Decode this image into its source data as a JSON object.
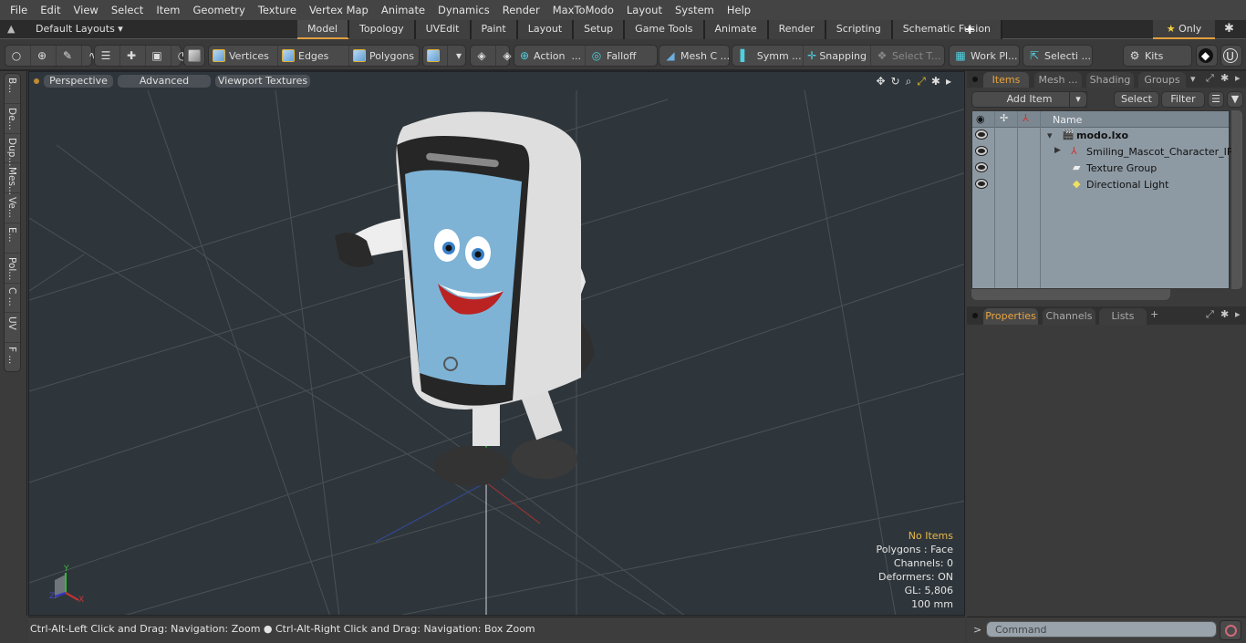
{
  "menubar": [
    "File",
    "Edit",
    "View",
    "Select",
    "Item",
    "Geometry",
    "Texture",
    "Vertex Map",
    "Animate",
    "Dynamics",
    "Render",
    "MaxToModo",
    "Layout",
    "System",
    "Help"
  ],
  "layoutbar": {
    "layouts_label": "Default Layouts ▾",
    "tabs": [
      "Model",
      "Topology",
      "UVEdit",
      "Paint",
      "Layout",
      "Setup",
      "Game Tools",
      "Animate",
      "Render",
      "Scripting",
      "Schematic Fusion"
    ],
    "active_tab": "Model",
    "add_tab": "+",
    "only_label": "Only"
  },
  "toolbar": {
    "vertices": "Vertices",
    "edges": "Edges",
    "polygons": "Polygons",
    "action": "Action",
    "falloff": "Falloff",
    "mesh_constraint": "Mesh C ...",
    "symmetry": "Symm ...",
    "snapping": "Snapping",
    "select_through": "Select T...",
    "work_plane": "Work Pl...",
    "selection": "Selecti ...",
    "kits": "Kits",
    "ellipsis": "..."
  },
  "left_tabs": [
    "B...",
    "De...",
    "Dup...",
    "Mes...",
    "Ve...",
    "E...",
    "Pol...",
    "C ...",
    "UV",
    "F ..."
  ],
  "viewport": {
    "perspective": "Perspective",
    "advanced": "Advanced",
    "textures": "Viewport Textures",
    "info": {
      "selection": "No Items",
      "polygons": "Polygons : Face",
      "channels": "Channels: 0",
      "deformers": "Deformers: ON",
      "gl": "GL: 5,806",
      "unit": "100 mm"
    },
    "axis": {
      "x": "X",
      "y": "Y",
      "z": "Z"
    }
  },
  "status": "Ctrl-Alt-Left Click and Drag: Navigation: Zoom ● Ctrl-Alt-Right Click and Drag: Navigation: Box Zoom",
  "items_panel": {
    "tabs": [
      "Items",
      "Mesh ...",
      "Shading",
      "Groups"
    ],
    "active_tab": "Items",
    "add_item": "Add Item",
    "select": "Select",
    "filter": "Filter",
    "column_name": "Name",
    "rows": [
      {
        "name": "modo.lxo",
        "bold": true
      },
      {
        "name": "Smiling_Mascot_Character_IP..."
      },
      {
        "name": "Texture Group"
      },
      {
        "name": "Directional Light"
      }
    ]
  },
  "properties_panel": {
    "tabs": [
      "Properties",
      "Channels",
      "Lists"
    ],
    "active_tab": "Properties",
    "add_tab": "+"
  },
  "command": {
    "prompt": ">",
    "placeholder": "Command"
  },
  "colors": {
    "accent": "#e0a040",
    "viewport_bg": "#2f363b",
    "tree_bg": "#8e9aa3"
  }
}
